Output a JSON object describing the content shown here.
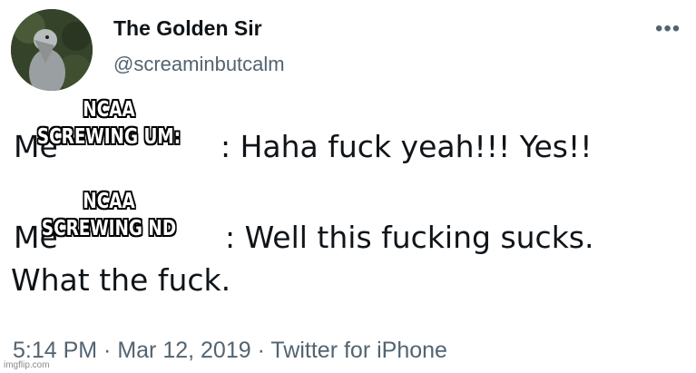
{
  "tweet": {
    "display_name": "The Golden Sir",
    "handle": "@screaminbutcalm",
    "more_icon": "more-horizontal-icon",
    "line1_prefix": "Me",
    "line1_rest": ": Haha fuck yeah!!! Yes!!",
    "line2_prefix": "Me",
    "line2_rest": ": Well this fucking sucks.",
    "line3": "What the fuck.",
    "meta": "5:14 PM · Mar 12, 2019 · Twitter for iPhone"
  },
  "captions": {
    "caption1": [
      "NCAA",
      "SCREWING UM:"
    ],
    "caption2": [
      "NCAA",
      "SCREWING ND"
    ]
  },
  "watermark": "imgflip.com"
}
